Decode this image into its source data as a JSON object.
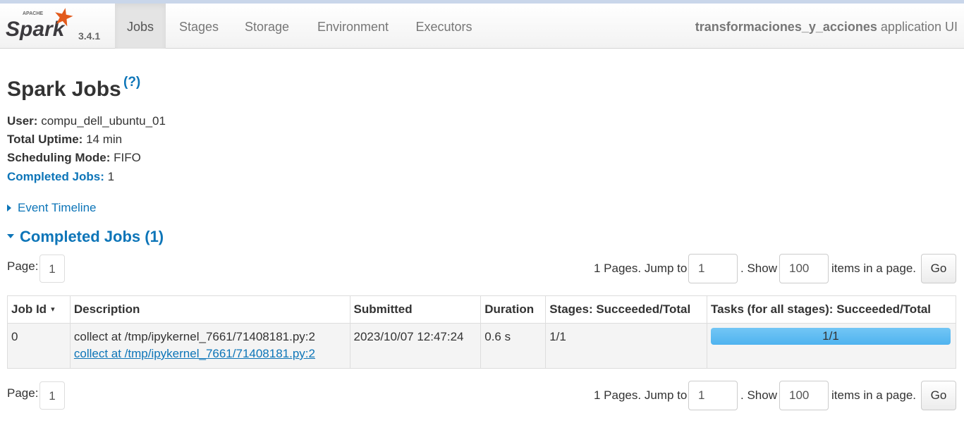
{
  "brand": {
    "small_label": "APACHE",
    "name": "Spark",
    "version": "3.4.1"
  },
  "nav": {
    "items": [
      {
        "label": "Jobs"
      },
      {
        "label": "Stages"
      },
      {
        "label": "Storage"
      },
      {
        "label": "Environment"
      },
      {
        "label": "Executors"
      }
    ],
    "active": "Jobs",
    "app_name": "transformaciones_y_acciones",
    "app_suffix": " application UI"
  },
  "page": {
    "title": "Spark Jobs",
    "help": "(?)",
    "info": {
      "user_key": "User:",
      "user_val": " compu_dell_ubuntu_01",
      "uptime_key": "Total Uptime:",
      "uptime_val": " 14 min",
      "mode_key": "Scheduling Mode:",
      "mode_val": " FIFO",
      "completed_key": "Completed Jobs:",
      "completed_val": " 1"
    },
    "event_timeline": "Event Timeline",
    "completed_section": "Completed Jobs (1)"
  },
  "pager": {
    "page_label": "Page:",
    "current_page": "1",
    "pages_text": "1 Pages. Jump to",
    "jump_value": "1",
    "show_text": ". Show",
    "show_value": "100",
    "items_text": "items in a page.",
    "go_label": "Go"
  },
  "table": {
    "headers": [
      "Job Id",
      "Description",
      "Submitted",
      "Duration",
      "Stages: Succeeded/Total",
      "Tasks (for all stages): Succeeded/Total"
    ],
    "sort_indicator": "▾",
    "rows": [
      {
        "job_id": "0",
        "description": "collect at /tmp/ipykernel_7661/71408181.py:2",
        "description_link": "collect at /tmp/ipykernel_7661/71408181.py:2",
        "submitted": "2023/10/07 12:47:24",
        "duration": "0.6 s",
        "stages": "1/1",
        "tasks": "1/1",
        "tasks_progress": 1.0
      }
    ]
  },
  "colors": {
    "link": "#0d75b8",
    "progress_bar": "#5ab8f0",
    "spark_star": "#e25a1c"
  }
}
